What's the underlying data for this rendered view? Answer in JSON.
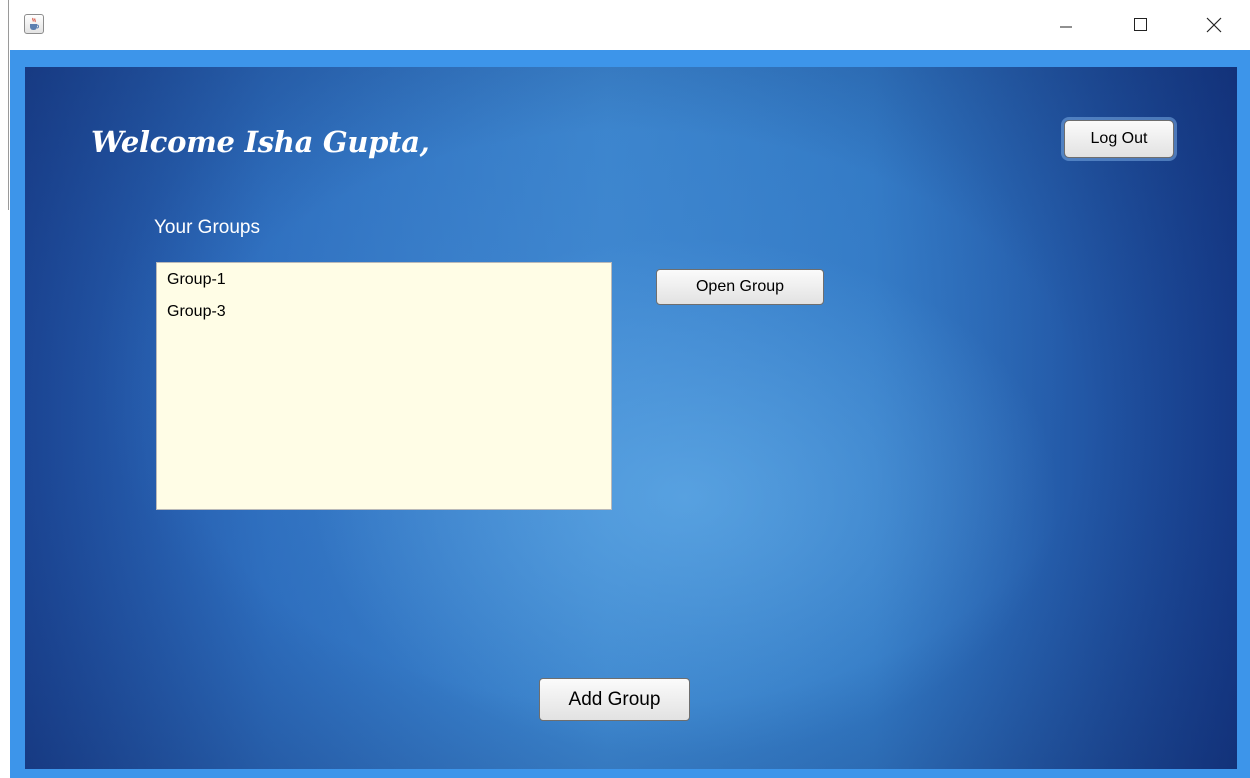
{
  "window": {
    "app_icon": "java-cup-icon",
    "controls": [
      "minimize-icon",
      "maximize-icon",
      "close-icon"
    ]
  },
  "colors": {
    "frame": "#3d95ea",
    "list_background": "#fffde6",
    "background_blue": "#2d6dbd"
  },
  "header": {
    "welcome_text": "Welcome Isha Gupta,",
    "logout_label": "Log Out"
  },
  "groups": {
    "label": "Your Groups",
    "items": [
      "Group-1",
      "Group-3"
    ],
    "open_label": "Open Group",
    "add_label": "Add Group"
  }
}
